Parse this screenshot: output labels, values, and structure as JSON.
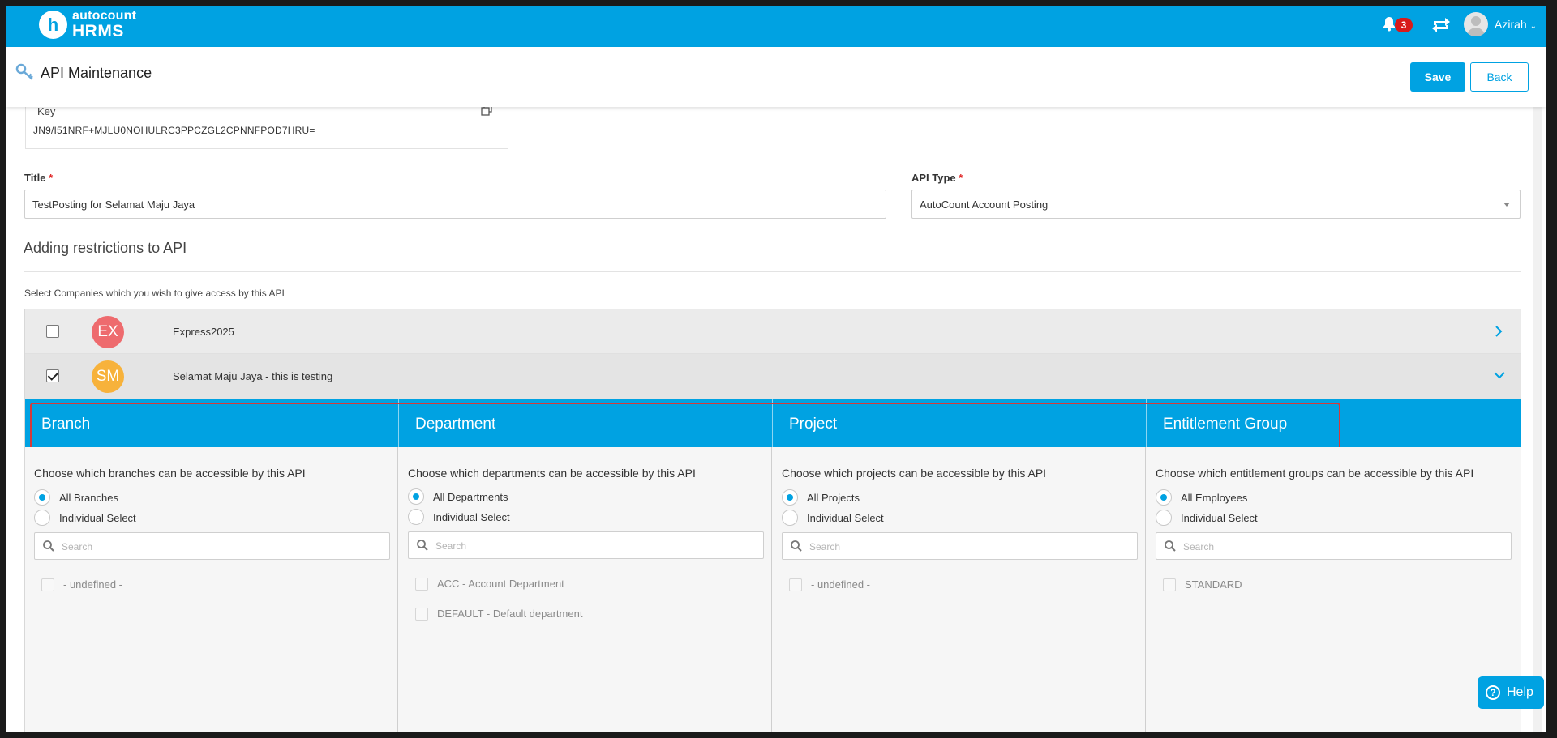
{
  "app": {
    "logo_letter": "h",
    "logo_line1": "autocount",
    "logo_line2": "HRMS",
    "notification_count": "3",
    "username": "Azirah",
    "brand_color": "#00a2e2"
  },
  "page": {
    "title": "API Maintenance",
    "save_label": "Save",
    "back_label": "Back"
  },
  "form": {
    "key_label": "Key",
    "key_value": "JN9/I51NRF+MJLU0NOHULRC3PPCZGL2CPNNFPOD7HRU=",
    "title_label": "Title",
    "title_value": "TestPosting for Selamat Maju Jaya",
    "api_type_label": "API Type",
    "api_type_value": "AutoCount Account Posting",
    "required_mark": "*"
  },
  "restrictions": {
    "heading": "Adding restrictions to API",
    "companies_label": "Select Companies which you wish to give access by this API",
    "companies": [
      {
        "initials": "EX",
        "name": "Express2025",
        "checked": false,
        "color": "#ee6b6e",
        "expanded": false
      },
      {
        "initials": "SM",
        "name": "Selamat Maju Jaya - this is testing",
        "checked": true,
        "color": "#f7b23b",
        "expanded": true
      }
    ],
    "tabs": [
      {
        "label": "Branch",
        "description": "Choose which branches can be accessible by this API",
        "option_all": "All Branches",
        "option_individual": "Individual Select",
        "search_placeholder": "Search",
        "items": [
          "- undefined -"
        ]
      },
      {
        "label": "Department",
        "description": "Choose which departments can be accessible by this API",
        "option_all": "All Departments",
        "option_individual": "Individual Select",
        "search_placeholder": "Search",
        "items": [
          "ACC - Account Department",
          "DEFAULT - Default department"
        ]
      },
      {
        "label": "Project",
        "description": "Choose which projects can be accessible by this API",
        "option_all": "All Projects",
        "option_individual": "Individual Select",
        "search_placeholder": "Search",
        "items": [
          "- undefined -"
        ]
      },
      {
        "label": "Entitlement Group",
        "description": "Choose which entitlement groups can be accessible by this API",
        "option_all": "All Employees",
        "option_individual": "Individual Select",
        "search_placeholder": "Search",
        "items": [
          "STANDARD"
        ]
      }
    ]
  },
  "help": {
    "label": "Help",
    "icon": "?"
  }
}
